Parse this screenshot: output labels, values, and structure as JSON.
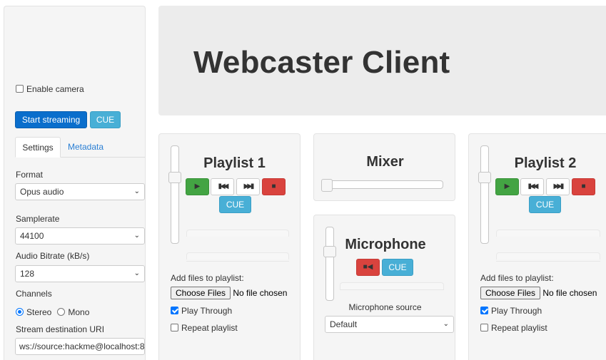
{
  "sidebar": {
    "enable_camera_label": "Enable camera",
    "start_streaming_label": "Start streaming",
    "cue_label": "CUE",
    "tabs": [
      {
        "label": "Settings",
        "active": true
      },
      {
        "label": "Metadata",
        "active": false
      }
    ],
    "format": {
      "label": "Format",
      "value": "Opus audio"
    },
    "samplerate": {
      "label": "Samplerate",
      "value": "44100"
    },
    "bitrate": {
      "label": "Audio Bitrate (kB/s)",
      "value": "128"
    },
    "channels": {
      "label": "Channels",
      "stereo": "Stereo",
      "mono": "Mono",
      "selected": "Stereo"
    },
    "uri": {
      "label": "Stream destination URI",
      "value": "ws://source:hackme@localhost:8"
    }
  },
  "header": {
    "title": "Webcaster Client"
  },
  "playlist1": {
    "title": "Playlist 1",
    "cue_label": "CUE",
    "add_files_label": "Add files to playlist:",
    "choose_files_label": "Choose Files",
    "no_file_label": "No file chosen",
    "play_through_label": "Play Through",
    "play_through_checked": true,
    "repeat_label": "Repeat playlist",
    "repeat_checked": false
  },
  "mixer": {
    "title": "Mixer"
  },
  "microphone": {
    "title": "Microphone",
    "cue_label": "CUE",
    "source_label": "Microphone source",
    "source_value": "Default"
  },
  "playlist2": {
    "title": "Playlist 2",
    "cue_label": "CUE",
    "add_files_label": "Add files to playlist:",
    "choose_files_label": "Choose Files",
    "no_file_label": "No file chosen",
    "play_through_label": "Play Through",
    "play_through_checked": true,
    "repeat_label": "Repeat playlist",
    "repeat_checked": false
  },
  "icons": {
    "play": "play-icon",
    "prev": "skip-backward-icon",
    "next": "skip-forward-icon",
    "stop": "stop-icon",
    "camera": "video-camera-icon",
    "caret": "chevron-down-icon"
  },
  "colors": {
    "primary": "#0a6ecc",
    "info": "#48afd6",
    "success": "#43a443",
    "danger": "#d9433e"
  }
}
